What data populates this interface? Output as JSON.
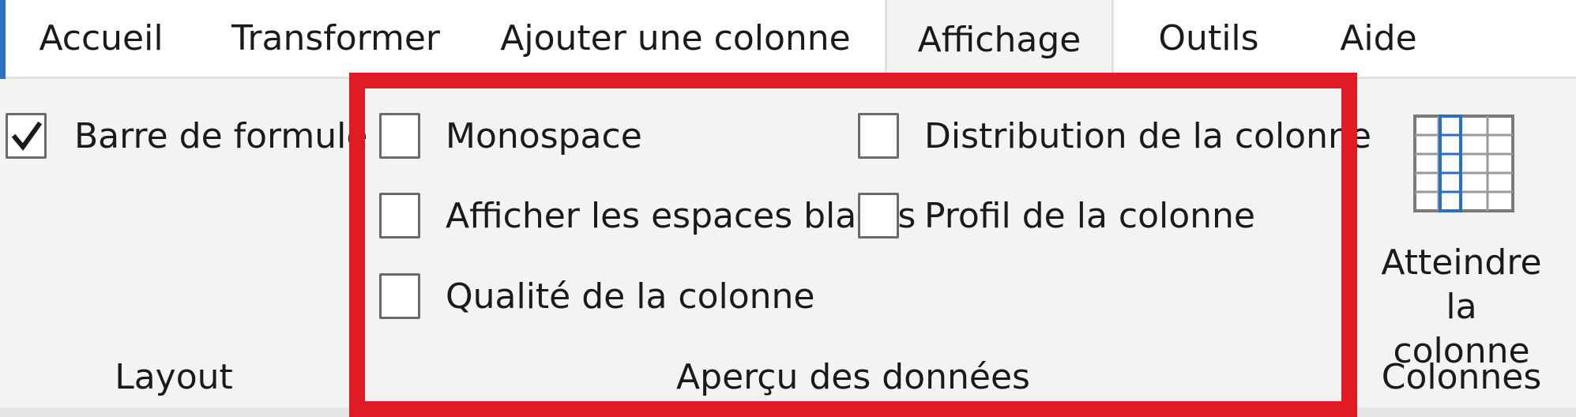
{
  "tabs": [
    {
      "label": "Accueil"
    },
    {
      "label": "Transformer"
    },
    {
      "label": "Ajouter une colonne"
    },
    {
      "label": "Affichage"
    },
    {
      "label": "Outils"
    },
    {
      "label": "Aide"
    }
  ],
  "active_tab": "Affichage",
  "layout_group": {
    "label": "Layout",
    "formula_bar": {
      "label": "Barre de formule",
      "checked": true
    }
  },
  "data_preview_group": {
    "label": "Aperçu des données",
    "options": [
      {
        "label": "Monospace",
        "checked": false
      },
      {
        "label": "Afficher les espaces blancs",
        "checked": false
      },
      {
        "label": "Qualité de la colonne",
        "checked": false
      },
      {
        "label": "Distribution de la colonne",
        "checked": false
      },
      {
        "label": "Profil de la colonne",
        "checked": false
      }
    ]
  },
  "columns_group": {
    "label": "Colonnes",
    "goto_column": {
      "line1": "Atteindre la",
      "line2": "colonne",
      "icon": "table-grid-icon"
    }
  },
  "colors": {
    "highlight": "#e01b24",
    "accent": "#2b6fc2"
  }
}
